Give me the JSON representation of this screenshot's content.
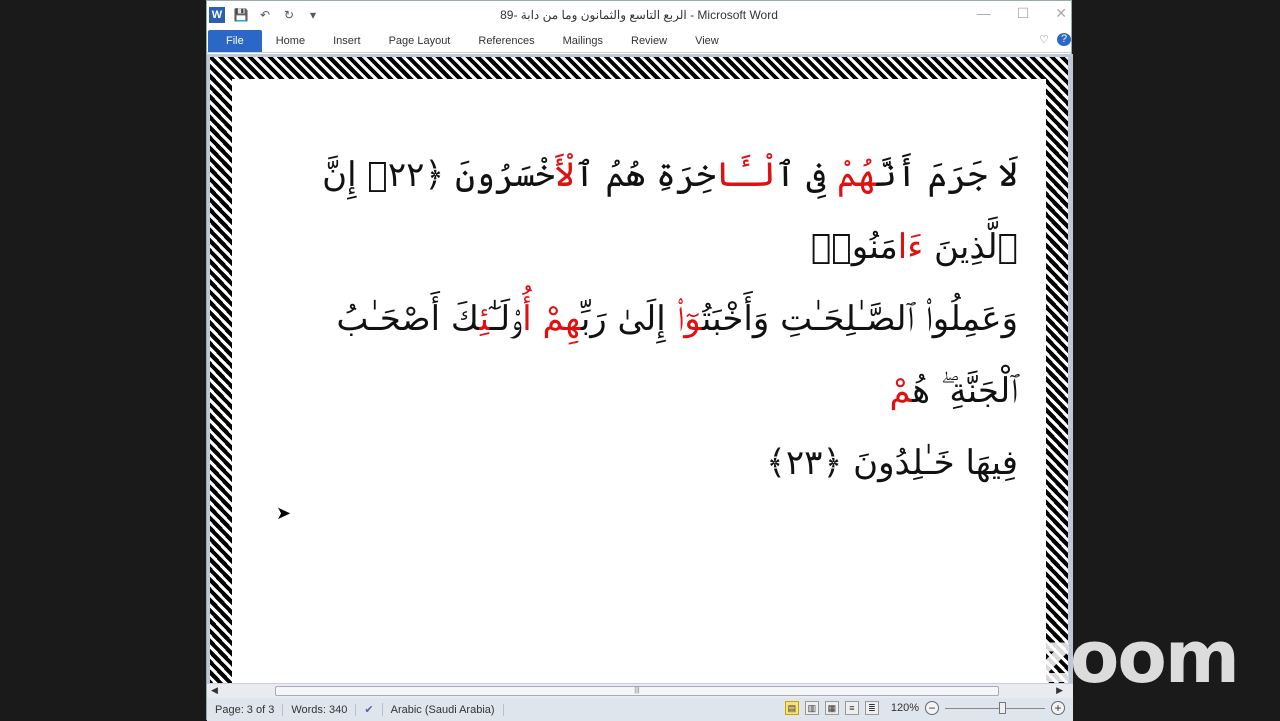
{
  "title": "الربع التاسع والثمانون وما من دابة -89 - Microsoft Word",
  "qat": {
    "app_icon": "W",
    "save": "💾",
    "undo": "↶",
    "redo": "↻",
    "customize": "▾"
  },
  "window_controls": {
    "minimize": "—",
    "maximize": "☐",
    "close": "✕"
  },
  "tabs": [
    "File",
    "Home",
    "Insert",
    "Page Layout",
    "References",
    "Mailings",
    "Review",
    "View"
  ],
  "ribbon_right": {
    "collapse": "♡",
    "help": "?"
  },
  "document": {
    "lines": [
      [
        {
          "t": "لَا جَرَمَ أَنَّ",
          "red": false
        },
        {
          "t": "هُمْ",
          "red": true
        },
        {
          "t": " فِى ٱ",
          "red": false
        },
        {
          "t": "لْـَٔا",
          "red": true
        },
        {
          "t": "خِرَةِ هُمُ ٱ",
          "red": false
        },
        {
          "t": "لْأَ",
          "red": true
        },
        {
          "t": "خْسَرُونَ ﴿٢٢﴾ إِنَّ ٱلَّذِينَ ",
          "red": false
        },
        {
          "t": "ءَا",
          "red": true
        },
        {
          "t": "مَنُوا۟",
          "red": false
        }
      ],
      [
        {
          "t": "وَعَمِلُوا۟ ٱلصَّـٰلِحَـٰتِ وَأَخْبَتُ",
          "red": false
        },
        {
          "t": "وٓا۟",
          "red": true
        },
        {
          "t": " إِلَىٰ رَبِّ",
          "red": false
        },
        {
          "t": "هِمْ أُ",
          "red": true
        },
        {
          "t": "و۟لَـٰٓ",
          "red": false
        },
        {
          "t": "ئِ",
          "red": true
        },
        {
          "t": "كَ أَصْحَـٰبُ ٱلْجَنَّةِ ۖ هُ",
          "red": false
        },
        {
          "t": "مْ",
          "red": true
        }
      ],
      [
        {
          "t": "فِيهَا خَـٰلِدُونَ ﴿٢٣﴾",
          "red": false
        }
      ]
    ]
  },
  "scroll": {
    "left": "◀",
    "right": "▶",
    "grip": "|||"
  },
  "status": {
    "page": "Page: 3 of 3",
    "words": "Words: 340",
    "proofing": "✔",
    "language": "Arabic (Saudi Arabia)",
    "zoom": "120%",
    "zoom_out": "−",
    "zoom_in": "+",
    "zoom_level_percent": 120
  },
  "views": [
    "▤",
    "▥",
    "▦",
    "≡",
    "≣"
  ],
  "watermark": "zoom",
  "colors": {
    "red": "#e01010",
    "file_tab": "#2b67c6"
  }
}
